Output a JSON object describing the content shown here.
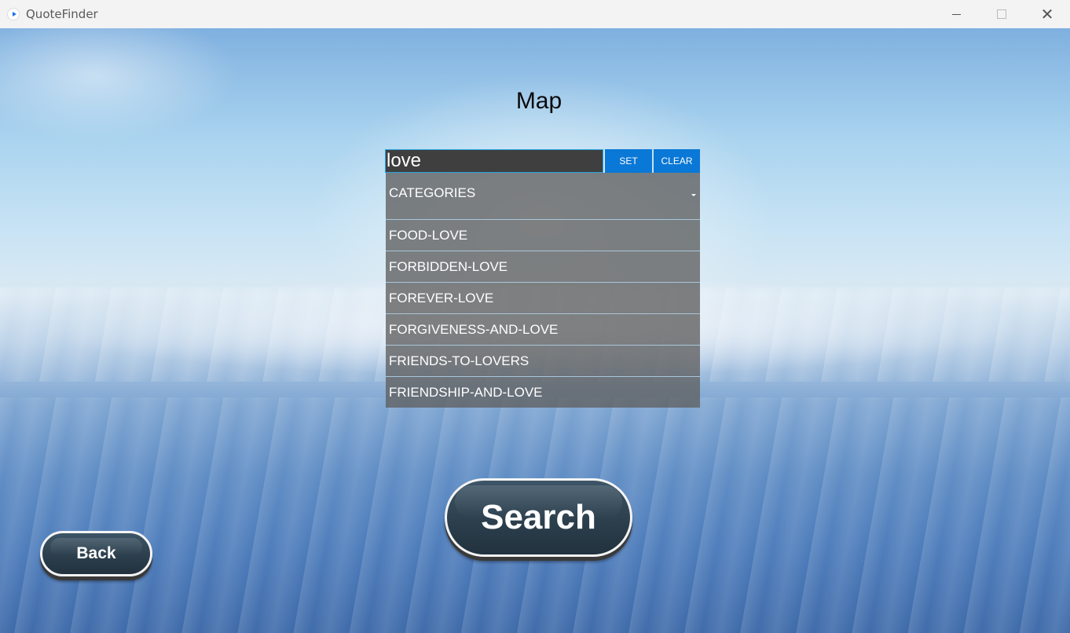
{
  "window": {
    "title": "QuoteFinder",
    "controls": {
      "minimize": "",
      "maximize": "",
      "close": "✕"
    }
  },
  "page": {
    "title": "Map"
  },
  "search": {
    "value": "love",
    "set_label": "SET",
    "clear_label": "CLEAR"
  },
  "categories": {
    "header": "CATEGORIES",
    "items": [
      {
        "label": "FOOD-LOVE"
      },
      {
        "label": "FORBIDDEN-LOVE"
      },
      {
        "label": "FOREVER-LOVE"
      },
      {
        "label": "FORGIVENESS-AND-LOVE"
      },
      {
        "label": "FRIENDS-TO-LOVERS"
      },
      {
        "label": "FRIENDSHIP-AND-LOVE"
      }
    ]
  },
  "actions": {
    "search_label": "Search",
    "back_label": "Back"
  },
  "colors": {
    "accent": "#0a78d6",
    "input_border": "#29a3e0",
    "button_dark": "#2c3f4d"
  }
}
